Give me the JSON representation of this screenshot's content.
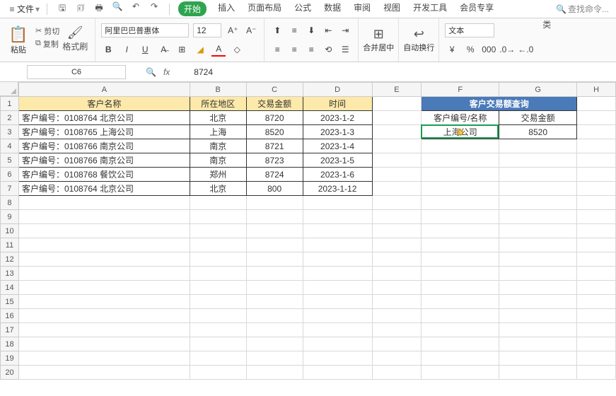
{
  "menubar": {
    "file": "文件",
    "tabs": [
      "开始",
      "插入",
      "页面布局",
      "公式",
      "数据",
      "审阅",
      "视图",
      "开发工具",
      "会员专享"
    ],
    "active_tab": 0,
    "search_placeholder": "查找命令..."
  },
  "ribbon": {
    "paste": "粘贴",
    "cut": "剪切",
    "copy": "复制",
    "format_painter": "格式刷",
    "font_name": "阿里巴巴普惠体",
    "font_size": "12",
    "merge_center": "合并居中",
    "auto_wrap": "自动换行",
    "number_format": "文本",
    "type_label": "类"
  },
  "formula_bar": {
    "name_box": "C6",
    "formula": "8724"
  },
  "columns": [
    "A",
    "B",
    "C",
    "D",
    "E",
    "F",
    "G",
    "H"
  ],
  "sheet": {
    "headers_main": [
      "客户名称",
      "所在地区",
      "交易金额",
      "时间"
    ],
    "rows": [
      {
        "name": "客户编号：0108764 北京公司",
        "region": "北京",
        "amount": "8720",
        "date": "2023-1-2"
      },
      {
        "name": "客户编号：0108765 上海公司",
        "region": "上海",
        "amount": "8520",
        "date": "2023-1-3"
      },
      {
        "name": "客户编号：0108766 南京公司",
        "region": "南京",
        "amount": "8721",
        "date": "2023-1-4"
      },
      {
        "name": "客户编号：0108766 南京公司",
        "region": "南京",
        "amount": "8723",
        "date": "2023-1-5"
      },
      {
        "name": "客户编号：0108768 餐饮公司",
        "region": "郑州",
        "amount": "8724",
        "date": "2023-1-6"
      },
      {
        "name": "客户编号：0108764 北京公司",
        "region": "北京",
        "amount": "800",
        "date": "2023-1-12"
      }
    ],
    "lookup_title": "客户交易额查询",
    "lookup_headers": [
      "客户编号/名称",
      "交易金额"
    ],
    "lookup_value": "上海公司",
    "lookup_result": "8520"
  }
}
